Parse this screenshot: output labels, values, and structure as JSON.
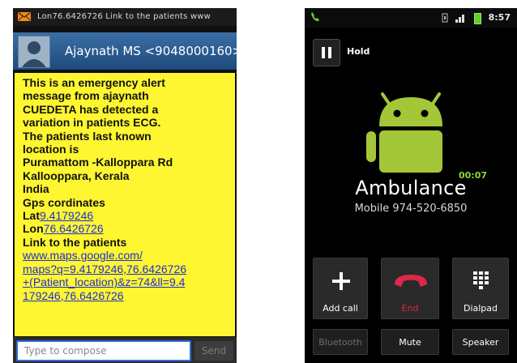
{
  "sms": {
    "status_text": "Lon76.6426726 Link to the patients  www",
    "sender": "Ajaynath MS <9048000160>",
    "message": {
      "intro_lines": [
        "This is an emergency alert",
        "message from ajaynath",
        "CUEDETA has detected a",
        "variation in patients ECG.",
        "The patients last known",
        "location is",
        " Puramattom -Kalloppara Rd",
        "Kallooppara, Kerala",
        "India",
        "Gps cordinates"
      ],
      "lat_label": "Lat",
      "lat_value": "9.4179246",
      "lon_label": "Lon",
      "lon_value": "76.6426726",
      "link_label": "Link to the patients",
      "link_lines": [
        " www.maps.google.com/",
        "maps?q=9.4179246,76.6426726",
        "+(Patient_location)&z=74&ll=9.4",
        "179246,76.6426726"
      ]
    },
    "compose_placeholder": "Type to compose",
    "send_label": "Send"
  },
  "call": {
    "time": "8:57",
    "hold_label": "Hold",
    "timer": "00:07",
    "caller_name": "Ambulance",
    "caller_number": "Mobile 974-520-6850",
    "buttons": {
      "add_call": "Add call",
      "end": "End",
      "dialpad": "Dialpad",
      "bluetooth": "Bluetooth",
      "mute": "Mute",
      "speaker": "Speaker"
    }
  },
  "colors": {
    "sms_bubble": "#fef631",
    "link": "#1f2fd6",
    "end_red": "#e0264a",
    "android_green": "#a4c639",
    "timer_green": "#8fd33a"
  }
}
